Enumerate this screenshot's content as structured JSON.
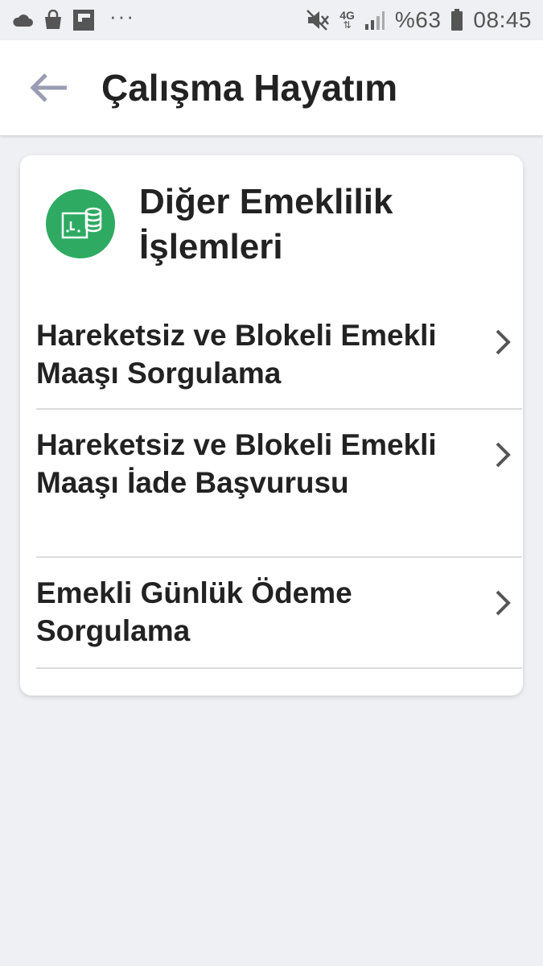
{
  "status_bar": {
    "battery_percent": "%63",
    "time": "08:45",
    "network_type": "4G",
    "overflow": "···",
    "icons": [
      "cloud-icon",
      "shopping-bag-icon",
      "flipboard-icon",
      "mute-icon",
      "signal-icon",
      "battery-icon"
    ]
  },
  "app_bar": {
    "title": "Çalışma Hayatım",
    "back_icon": "back-arrow-icon"
  },
  "card": {
    "title": "Diğer Emeklilik İşlemleri",
    "icon": "retirement-coins-icon",
    "icon_color": "#2eaa62",
    "items": [
      {
        "label": "Hareketsiz ve Blokeli Emekli Maaşı Sorgulama"
      },
      {
        "label": "Hareketsiz ve Blokeli Emekli Maaşı İade Başvurusu"
      },
      {
        "label": "Emekli Günlük Ödeme Sorgulama"
      }
    ]
  },
  "colors": {
    "background": "#eff0f3",
    "accent_green": "#2eaa62",
    "text": "#222222",
    "divider": "#dcdcdc"
  }
}
